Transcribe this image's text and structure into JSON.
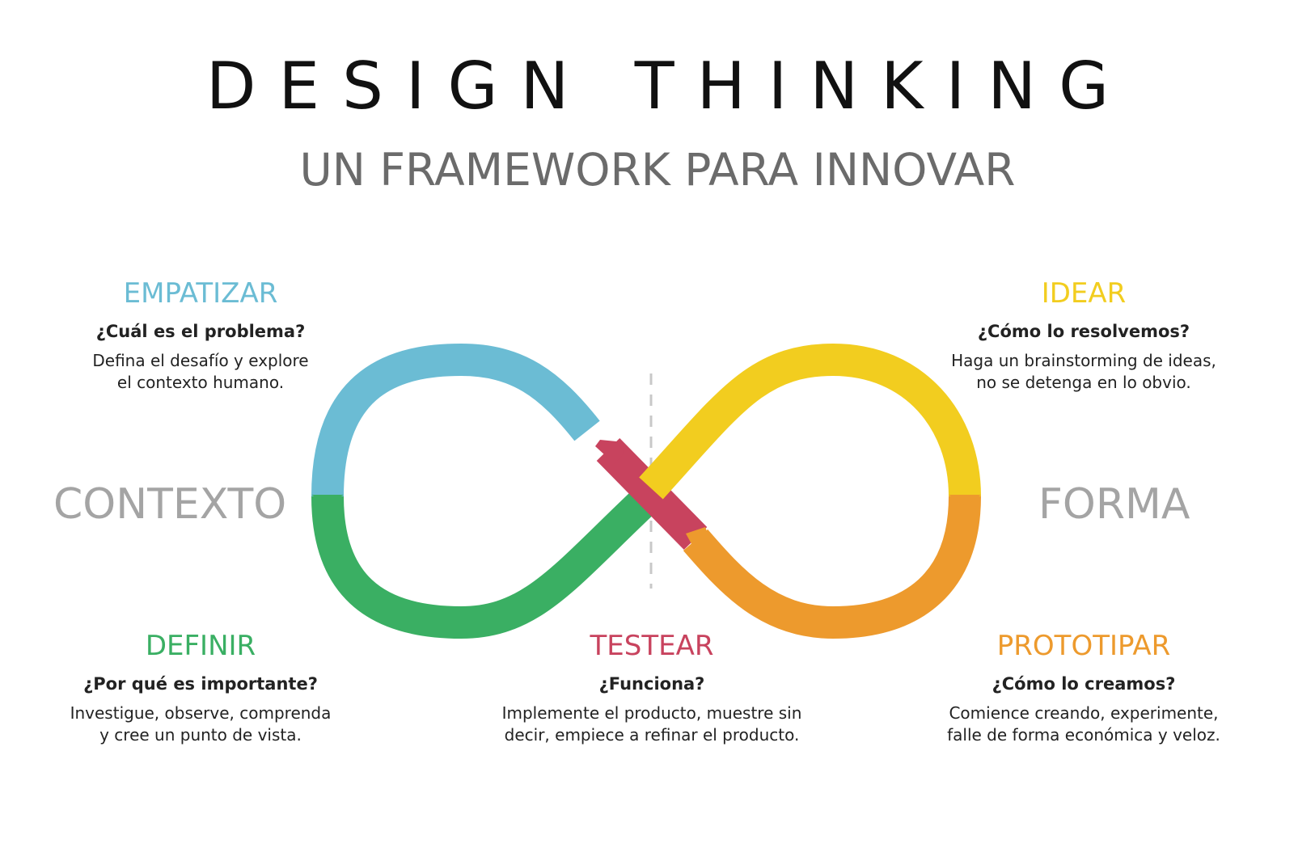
{
  "header": {
    "title": "DESIGN THINKING",
    "subtitle": "UN FRAMEWORK PARA INNOVAR"
  },
  "sides": {
    "left": "CONTEXTO",
    "right": "FORMA"
  },
  "stages": {
    "empatizar": {
      "name": "EMPATIZAR",
      "question": "¿Cuál es el problema?",
      "line1": "Defina el desafío y explore",
      "line2": "el contexto humano.",
      "color": "#6bbcd4"
    },
    "idear": {
      "name": "IDEAR",
      "question": "¿Cómo lo resolvemos?",
      "line1": "Haga un brainstorming de ideas,",
      "line2": "no se detenga en lo obvio.",
      "color": "#f2cd1f"
    },
    "definir": {
      "name": "DEFINIR",
      "question": "¿Por qué es importante?",
      "line1": "Investigue, observe, comprenda",
      "line2": "y cree un punto de vista.",
      "color": "#3aaf63"
    },
    "testear": {
      "name": "TESTEAR",
      "question": "¿Funciona?",
      "line1": "Implemente el producto, muestre sin",
      "line2": "decir, empiece a refinar el producto.",
      "color": "#c8435e"
    },
    "prototipar": {
      "name": "PROTOTIPAR",
      "question": "¿Cómo lo creamos?",
      "line1": "Comience creando, experimente,",
      "line2": "falle de forma económica y veloz.",
      "color": "#ed9a2d"
    }
  }
}
